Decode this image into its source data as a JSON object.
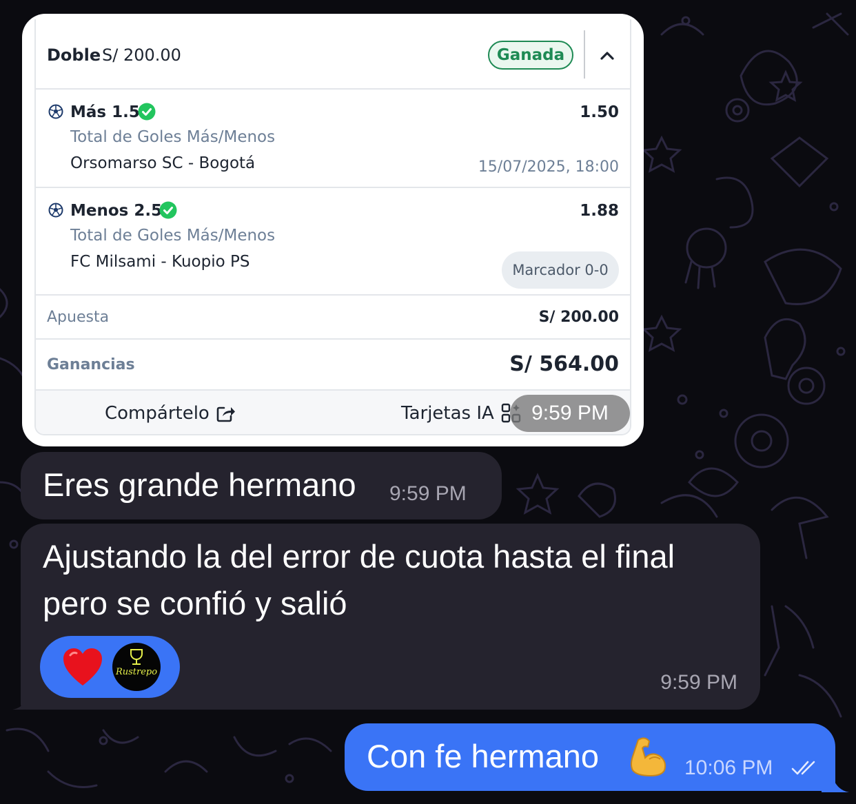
{
  "bet_card": {
    "bet_type": "Doble",
    "header_amount": "S/ 200.00",
    "status_badge": "Ganada",
    "selections": [
      {
        "pick": "Más 1.5",
        "odds": "1.50",
        "market": "Total de Goles Más/Menos",
        "event": "Orsomarso SC - Bogotá",
        "datetime": "15/07/2025, 18:00"
      },
      {
        "pick": "Menos 2.5",
        "odds": "1.88",
        "market": "Total de Goles Más/Menos",
        "event": "FC Milsami - Kuopio PS",
        "score_chip": "Marcador 0-0"
      }
    ],
    "stake_label": "Apuesta",
    "stake_value": "S/ 200.00",
    "winnings_label": "Ganancias",
    "winnings_value": "S/ 564.00",
    "share_label": "Compártelo",
    "ai_cards_label": "Tarjetas IA",
    "image_time": "9:59 PM"
  },
  "messages": [
    {
      "direction": "incoming",
      "text": "Eres grande hermano",
      "time": "9:59 PM"
    },
    {
      "direction": "incoming",
      "lines": [
        "Ajustando la del error de cuota hasta el final",
        "pero se confió y salió"
      ],
      "time": "9:59 PM",
      "reactions": [
        "red-heart",
        "avatar"
      ],
      "avatar_text": "Rustrepo"
    },
    {
      "direction": "outgoing",
      "text": "Con fe hermano",
      "emoji": "flexed-biceps",
      "time": "10:06 PM",
      "status": "read"
    }
  ],
  "colors": {
    "background": "#0b0b10",
    "incoming_bubble": "#25232e",
    "outgoing_bubble": "#3a74f6",
    "won_green": "#1e8a54",
    "check_green": "#22c55e"
  }
}
